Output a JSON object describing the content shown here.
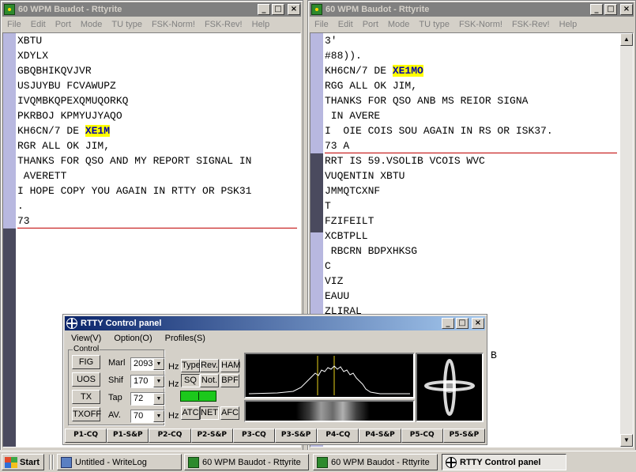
{
  "left_window": {
    "title": "60 WPM Baudot - Rttyrite",
    "menu": [
      "File",
      "Edit",
      "Port",
      "Mode",
      "TU type",
      "FSK-Norm!",
      "FSK-Rev!",
      "Help"
    ],
    "lines": [
      {
        "text": "XBTU"
      },
      {
        "text": "XDYLX"
      },
      {
        "text": "GBQBHIKQVJVR"
      },
      {
        "text": "USJUYBU FCVAWUPZ"
      },
      {
        "text": "IVQMBKQPEXQMUQORKQ"
      },
      {
        "text": "PKRBOJ KPMYUJYAQO"
      },
      {
        "text": "KH6CN/7 DE ",
        "callsign": "XE1M"
      },
      {
        "text": "RGR ALL OK JIM,"
      },
      {
        "text": "THANKS FOR QSO AND MY REPORT SIGNAL IN"
      },
      {
        "text": " AVERETT"
      },
      {
        "text": "I HOPE COPY YOU AGAIN IN RTTY OR PSK31"
      },
      {
        "text": "."
      },
      {
        "text": "73"
      }
    ]
  },
  "right_window": {
    "title": "60 WPM Baudot - Rttyrite",
    "menu": [
      "File",
      "Edit",
      "Port",
      "Mode",
      "TU type",
      "FSK-Norm!",
      "FSK-Rev!",
      "Help"
    ],
    "lines_top": [
      {
        "text": "3'"
      },
      {
        "text": "#88))."
      },
      {
        "text": "KH6CN/7 DE ",
        "callsign": "XE1MO"
      },
      {
        "text": "RGG ALL OK JIM,"
      },
      {
        "text": "THANKS FOR QSO ANB MS REIOR SIGNA"
      },
      {
        "text": " IN AVERE"
      },
      {
        "text": "I  OIE COIS SOU AGAIN IN RS OR ISK37."
      },
      {
        "text": "73 A"
      }
    ],
    "lines_bottom": [
      {
        "text": "RRT IS 59.VSOLIB VCOIS WVC"
      },
      {
        "text": "VUQENTIN XBTU"
      },
      {
        "text": "JMMQTCXNF"
      },
      {
        "text": "T"
      },
      {
        "text": "FZIFEILT"
      },
      {
        "text": "XCBTPLL"
      },
      {
        "text": " RBCRN BDPXHKSG"
      },
      {
        "text": "C"
      },
      {
        "text": "VIZ"
      },
      {
        "text": "EAUU"
      },
      {
        "text": "ZLIRAL"
      }
    ],
    "stray_char": "B"
  },
  "control_panel": {
    "title": "RTTY Control panel",
    "menu": [
      "View(V)",
      "Option(O)",
      "Profiles(S)"
    ],
    "group_label": "Control",
    "buttons": {
      "fig": "FIG",
      "uos": "UOS",
      "tx": "TX",
      "txoff": "TXOFF"
    },
    "mark": {
      "label": "Marl",
      "value": "2093",
      "unit": "Hz"
    },
    "shift": {
      "label": "Shif",
      "value": "170",
      "unit": "Hz"
    },
    "tap": {
      "label": "Tap",
      "value": "72"
    },
    "av": {
      "label": "AV.",
      "value": "70",
      "unit": "Hz"
    },
    "mode_buttons": {
      "type": "Type",
      "rev": "Rev.",
      "ham": "HAM",
      "sq": "SQ",
      "not": "Not.",
      "bpf": "BPF",
      "atc": "ATC",
      "net": "NET",
      "afc": "AFC"
    },
    "macro_tabs": [
      "P1-CQ",
      "P1-S&P",
      "P2-CQ",
      "P2-S&P",
      "P3-CQ",
      "P3-S&P",
      "P4-CQ",
      "P4-S&P",
      "P5-CQ",
      "P5-S&P"
    ]
  },
  "taskbar": {
    "start": "Start",
    "tasks": [
      "Untitled - WriteLog",
      "60 WPM Baudot - Rttyrite",
      "60 WPM Baudot - Rttyrite",
      "RTTY Control panel"
    ]
  },
  "colors": {
    "titlebar_active": "#0a246a",
    "callsign_highlight": "#ffff00",
    "callsign_text": "#0000aa",
    "divider": "#c00000",
    "tuning": "#1cc81c"
  }
}
